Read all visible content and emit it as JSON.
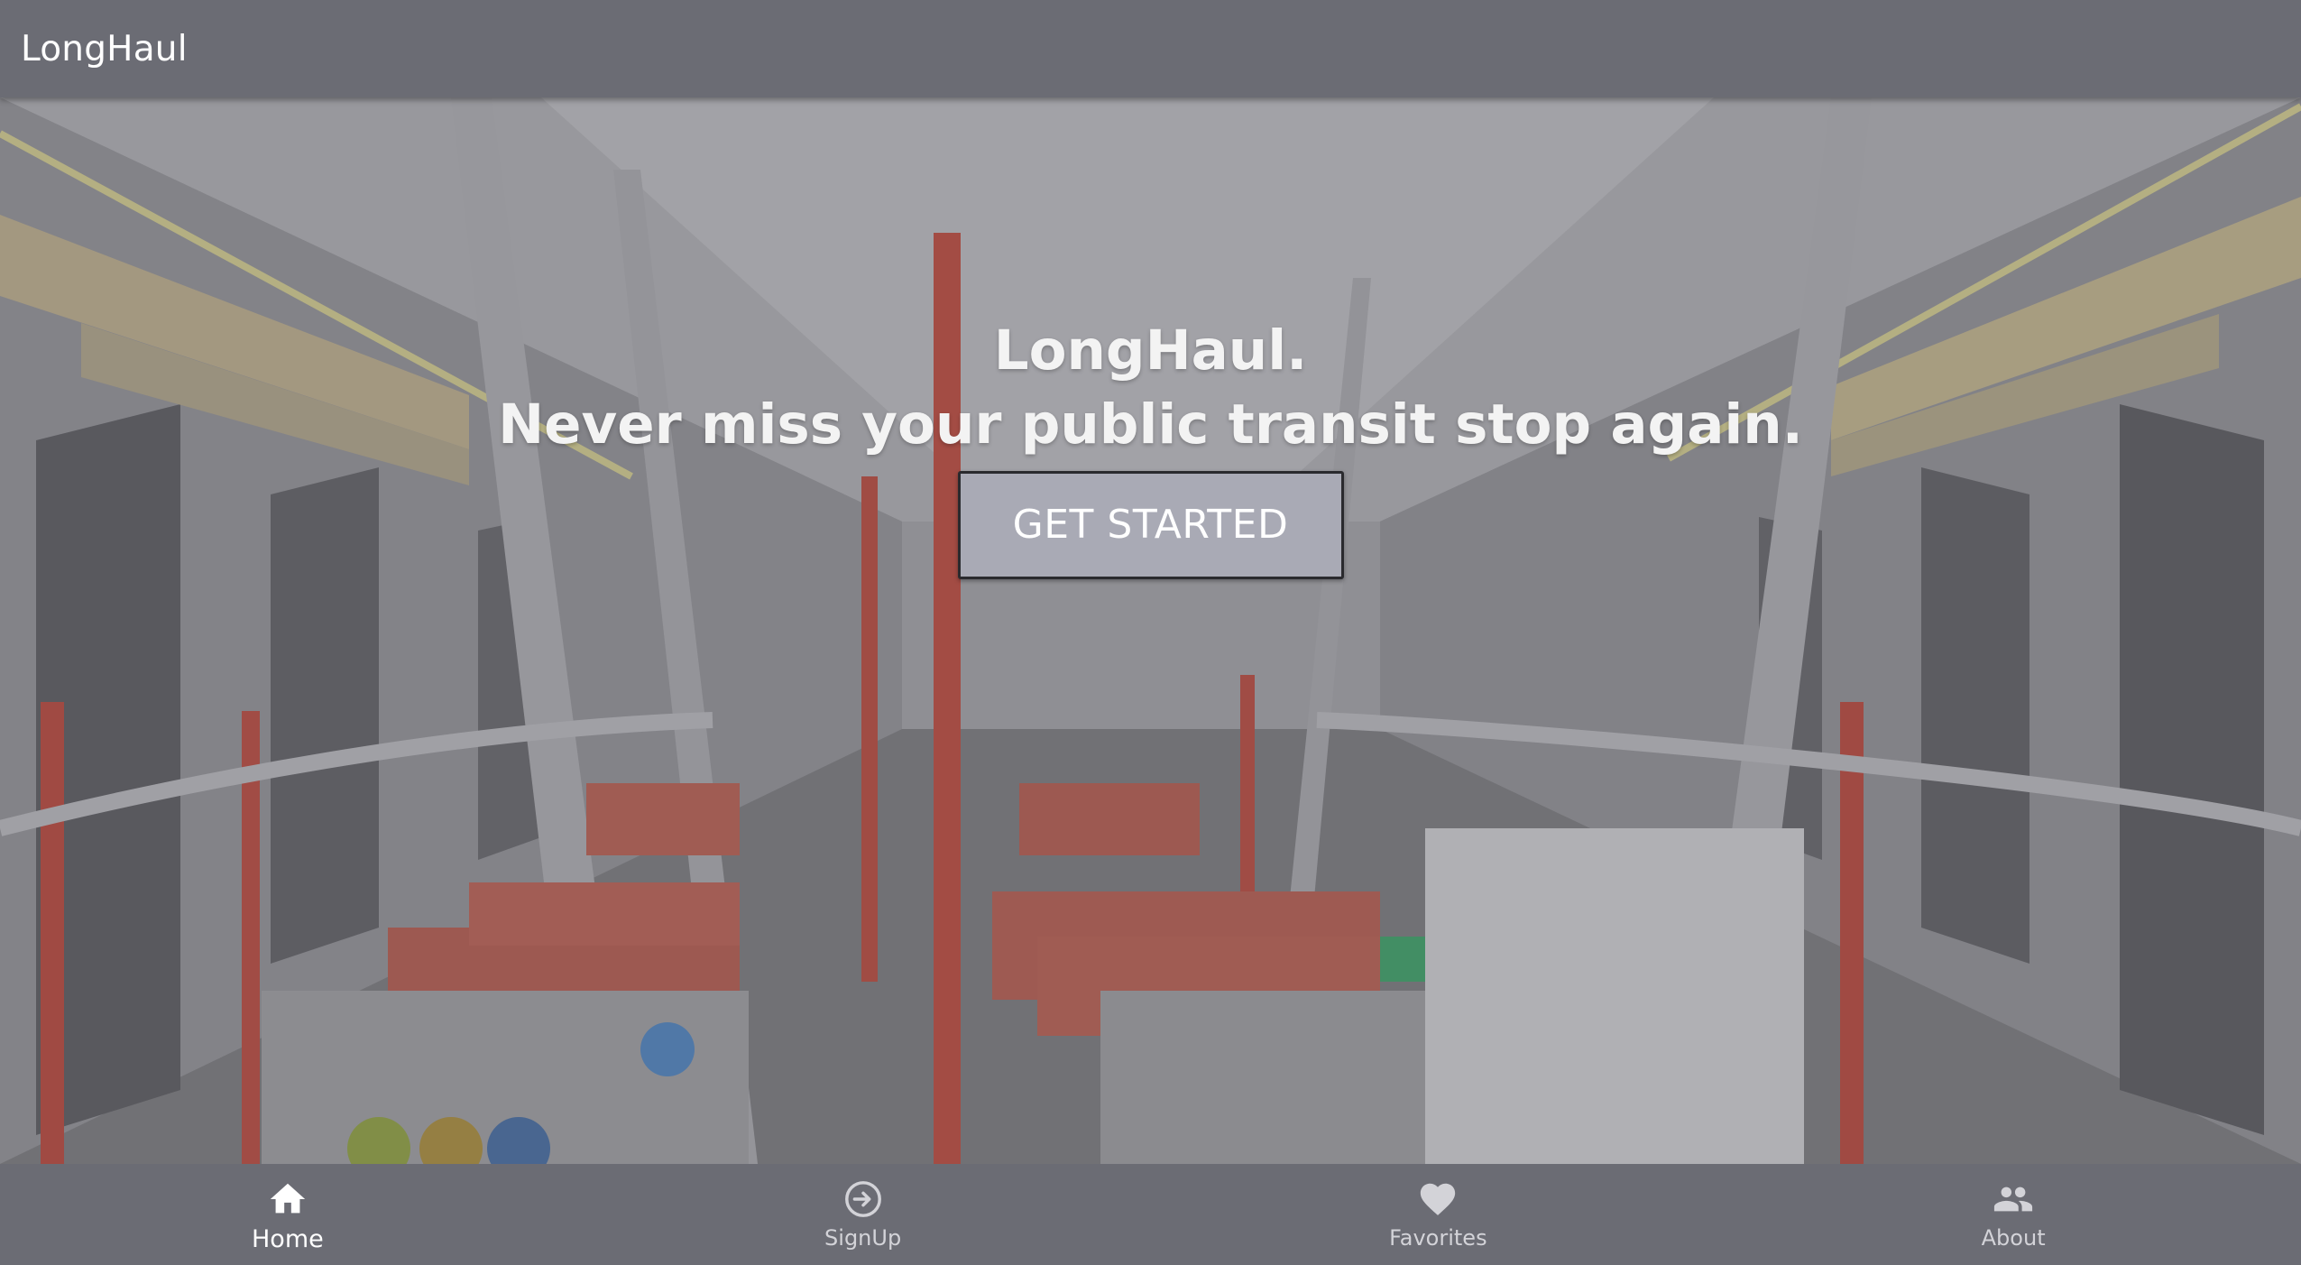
{
  "app_bar": {
    "title": "LongHaul"
  },
  "hero": {
    "headline": "LongHaul.",
    "tagline": "Never miss your public transit stop again.",
    "cta_label": "GET STARTED",
    "background_image": "subway-train-interior"
  },
  "bottom_nav": {
    "items": [
      {
        "label": "Home",
        "icon": "home-icon",
        "active": true
      },
      {
        "label": "SignUp",
        "icon": "login-icon",
        "active": false
      },
      {
        "label": "Favorites",
        "icon": "heart-icon",
        "active": false
      },
      {
        "label": "About",
        "icon": "people-icon",
        "active": false
      }
    ]
  },
  "colors": {
    "app_bar": "#6b6c74",
    "cta_background": "#a9aab5",
    "text_primary": "#ffffff",
    "nav_inactive_label": "#d3d3d8"
  }
}
